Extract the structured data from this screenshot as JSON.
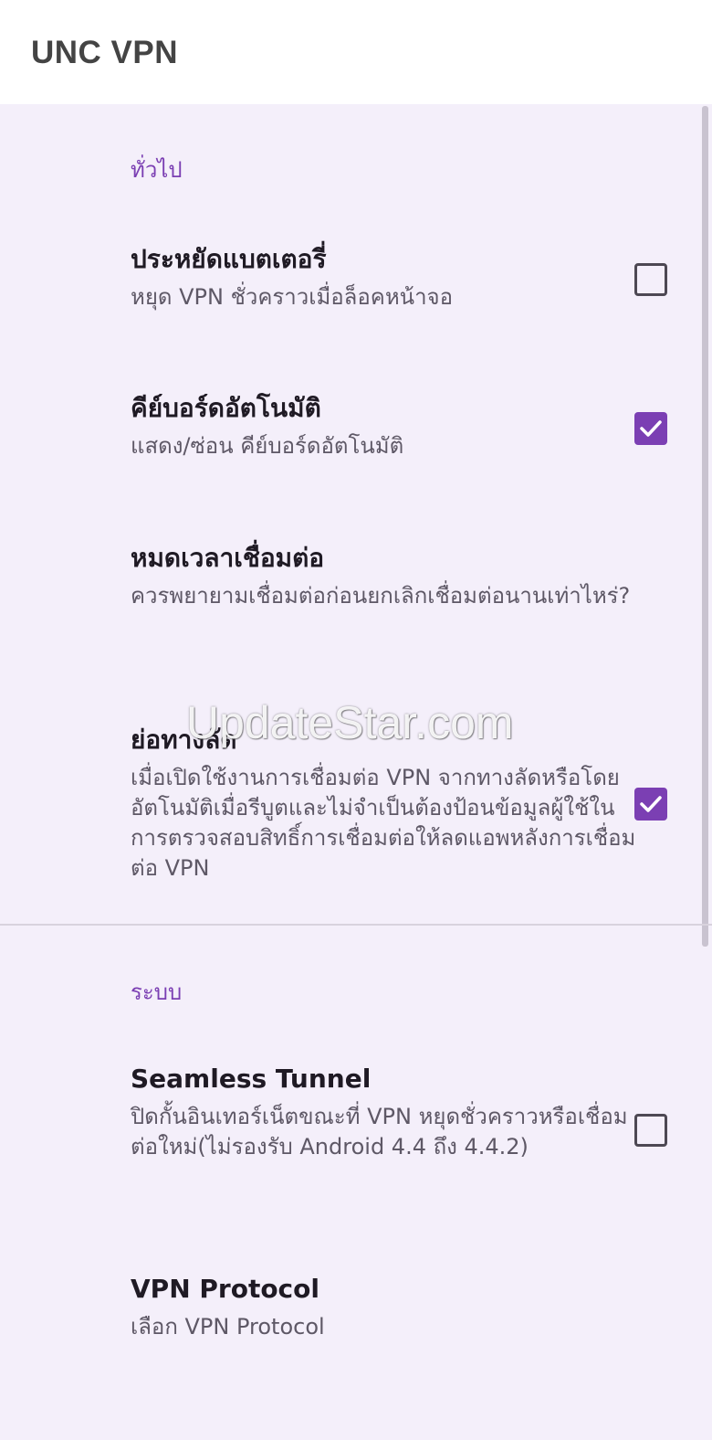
{
  "app": {
    "title": "UNC VPN"
  },
  "sections": [
    {
      "header": "ทั่วไป",
      "items": [
        {
          "title": "ประหยัดแบตเตอรี่",
          "summary": "หยุด VPN ชั่วคราวเมื่อล็อคหน้าจอ",
          "checked": false
        },
        {
          "title": "คีย์บอร์ดอัตโนมัติ",
          "summary": "แสดง/ซ่อน คีย์บอร์ดอัตโนมัติ",
          "checked": true
        },
        {
          "title": "หมดเวลาเชื่อมต่อ",
          "summary": "ควรพยายามเชื่อมต่อก่อนยกเลิกเชื่อมต่อนานเท่าไหร่?"
        },
        {
          "title": "ย่อทางลัด",
          "summary": "เมื่อเปิดใช้งานการเชื่อมต่อ VPN จากทางลัดหรือโดยอัตโนมัติเมื่อรีบูตและไม่จำเป็นต้องป้อนข้อมูลผู้ใช้ในการตรวจสอบสิทธิ์การเชื่อมต่อให้ลดแอพหลังการเชื่อมต่อ VPN",
          "checked": true
        }
      ]
    },
    {
      "header": "ระบบ",
      "items": [
        {
          "title": "Seamless Tunnel",
          "summary": "ปิดกั้นอินเทอร์เน็ตขณะที่ VPN หยุดชั่วคราวหรือเชื่อมต่อใหม่(ไม่รองรับ Android 4.4 ถึง 4.4.2)",
          "checked": false
        },
        {
          "title": "VPN Protocol",
          "summary": "เลือก VPN Protocol"
        }
      ]
    }
  ],
  "watermark": "UpdateStar.com",
  "colors": {
    "accent": "#7b3fb3",
    "background": "#f4effa",
    "appbar": "#ffffff"
  }
}
